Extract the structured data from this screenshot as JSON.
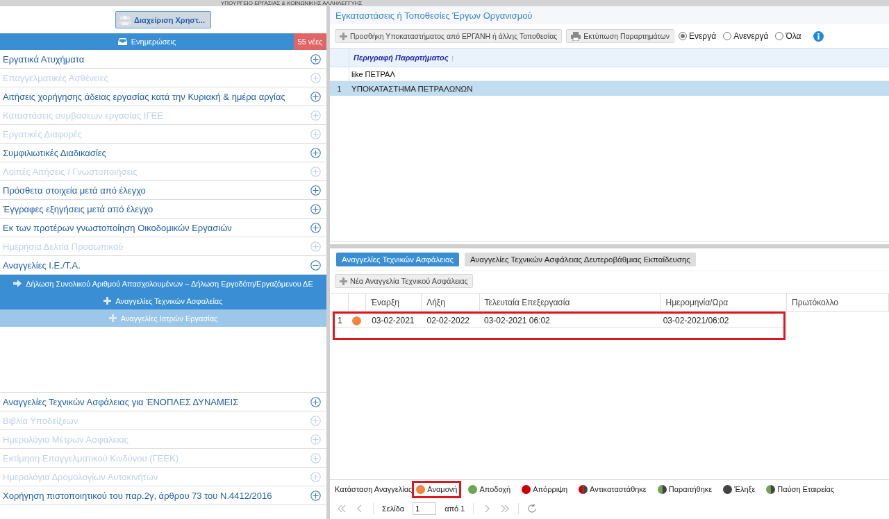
{
  "header": {
    "ministry": "ΥΠΟΥΡΓΕΙΟ ΕΡΓΑΣΙΑΣ & ΚΟΙΝΩΝΙΚΗΣ ΑΛΛΗΛΕΓΓΥΗΣ"
  },
  "sidebar": {
    "users_button": "Διαχείριση Χρηστ...",
    "updates": {
      "label": "Ενημερώσεις",
      "badge": "55 νέες"
    },
    "items": [
      {
        "label": "Εργατικά Ατυχήματα",
        "disabled": false,
        "expanded": false
      },
      {
        "label": "Επαγγελματικές Ασθένειες",
        "disabled": true,
        "expanded": false
      },
      {
        "label": "Αιτήσεις χορήγησης άδειας εργασίας κατά την Κυριακή & ημέρα αργίας",
        "disabled": false,
        "expanded": false
      },
      {
        "label": "Καταστάσεις συμβάσεων εργασίας ΙΓΕΕ",
        "disabled": true,
        "expanded": false
      },
      {
        "label": "Εργατικές Διαφορές",
        "disabled": true,
        "expanded": false
      },
      {
        "label": "Συμφιλιωτικές Διαδικασίες",
        "disabled": false,
        "expanded": false
      },
      {
        "label": "Λοιπές Αιτήσεις / Γνωστοποιήσεις",
        "disabled": true,
        "expanded": false
      },
      {
        "label": "Πρόσθετα στοιχεία μετά από έλεγχο",
        "disabled": false,
        "expanded": false
      },
      {
        "label": "Έγγραφες εξηγήσεις μετά από έλεγχο",
        "disabled": false,
        "expanded": false
      },
      {
        "label": "Εκ των προτέρων γνωστοποίηση Οικοδομικών Εργασιών",
        "disabled": false,
        "expanded": false
      },
      {
        "label": "Ημερήσια Δελτία Προσωπικού",
        "disabled": true,
        "expanded": false
      },
      {
        "label": "Αναγγελίες Ι.Ε./Τ.Α.",
        "disabled": false,
        "expanded": true,
        "children": [
          {
            "label": "Δήλωση Συνολικού Αριθμού Απασχολουμένων – Δήλωση Εργοδότη/Εργαζόμενου ΔΕ",
            "kind": "arrow",
            "disabled": false
          },
          {
            "label": "Αναγγελίες Τεχνικών Ασφαλείας",
            "kind": "plus",
            "disabled": false
          },
          {
            "label": "Αναγγελίες Ιατρών Εργασίας",
            "kind": "plus",
            "disabled": true
          }
        ]
      },
      {
        "label": "Αναγγελίες Τεχνικών Ασφάλειας για ΈΝΟΠΛΕΣ ΔΥΝΑΜΕΙΣ",
        "disabled": false,
        "expanded": false
      },
      {
        "label": "Βιβλία Υποδείξεων",
        "disabled": true,
        "expanded": false
      },
      {
        "label": "Ημερολόγιο Μέτρων Ασφάλειας",
        "disabled": true,
        "expanded": false
      },
      {
        "label": "Εκτίμηση Επαγγελματικού Κινδύνου (ΓΕΕΚ)",
        "disabled": true,
        "expanded": false
      },
      {
        "label": "Ημερολόγια Δρομολογίων Αυτοκινήτων",
        "disabled": true,
        "expanded": false
      },
      {
        "label": "Χορήγηση πιστοποιητικού του παρ.2γ, άρθρου 73 του Ν.4412/2016",
        "disabled": false,
        "expanded": false
      }
    ]
  },
  "sites": {
    "title": "Εγκαταστάσεις ή Τοποθεσίες Έργων Οργανισμού",
    "buttons": [
      {
        "label": "Προσθήκη Υποκαταστήματος από ΕΡΓΑΝΗ ή άλλης Τοποθεσίας",
        "kind": "add"
      },
      {
        "label": "Εκτύπωση Παραρτημάτων",
        "kind": "print"
      }
    ],
    "radios": [
      {
        "label": "Ενεργά",
        "selected": true
      },
      {
        "label": "Ανενεργά",
        "selected": false
      },
      {
        "label": "Όλα",
        "selected": false
      }
    ],
    "table": {
      "column": "Περιγραφή Παραρτήματος",
      "sort_arrow": "↑",
      "filter": "like ΠΕΤΡΑΛ",
      "rows": [
        {
          "number": "1",
          "text": "ΥΠΟΚΑΤΑΣΤΗΜΑ ΠΕΤΡΑΛΩΝΩΝ",
          "selected": true
        }
      ]
    }
  },
  "notices": {
    "tabs": [
      {
        "label": "Αναγγελίες Τεχνικών Ασφάλειας",
        "selected": true
      },
      {
        "label": "Αναγγελίες Τεχνικών Ασφάλειας Δευτεροβάθμιας Εκπαίδευσης",
        "selected": false
      }
    ],
    "new_button": "Νέα Αναγγελία Τεχνικού Ασφάλειας",
    "table": {
      "columns": [
        "Έναρξη",
        "Λήξη",
        "Τελευταία Επεξεργασία",
        "Ημερομηνία/Ωρα",
        "Πρωτόκολλο"
      ],
      "rows": [
        {
          "number": "1",
          "color": "#f5843c",
          "cells": [
            "03-02-2021",
            "02-02-2022",
            "03-02-2021 06:02",
            "03-02-2021/06:02"
          ],
          "highlighted": true
        }
      ]
    },
    "legend": {
      "label": "Κατάσταση Αναγγελίας",
      "items": [
        {
          "label": "Αναμονή",
          "kind": "solid",
          "color": "#f5843c",
          "highlighted": true
        },
        {
          "label": "Αποδοχή",
          "kind": "solid",
          "color": "#6aa84f",
          "highlighted": false
        },
        {
          "label": "Απόρριψη",
          "kind": "solid",
          "color": "#cc0000",
          "highlighted": false
        },
        {
          "label": "Αντικαταστάθηκε",
          "kind": "split",
          "color": "#cc0000",
          "highlighted": false
        },
        {
          "label": "Παραιτήθηκε",
          "kind": "split",
          "color": "#6aa84f",
          "highlighted": false
        },
        {
          "label": "Έληξε",
          "kind": "solid",
          "color": "#444444",
          "highlighted": false
        },
        {
          "label": "Παύση Εταιρείας",
          "kind": "split",
          "color": "#6aa84f",
          "highlighted": false
        }
      ]
    },
    "pager": {
      "page_label": "Σελίδα",
      "page": "1",
      "of": "από 1"
    }
  }
}
